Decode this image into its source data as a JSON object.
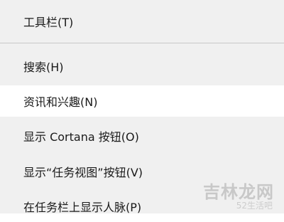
{
  "menu": {
    "items": [
      {
        "label": "工具栏(T)"
      },
      {
        "label": "搜索(H)"
      },
      {
        "label": "资讯和兴趣(N)"
      },
      {
        "label": "显示 Cortana 按钮(O)"
      },
      {
        "label": "显示“任务视图”按钮(V)"
      },
      {
        "label": "在任务栏上显示人脉(P)"
      }
    ],
    "highlighted_item": "资讯和兴趣(N)"
  },
  "watermark": {
    "text": "吉林龙网",
    "subtext": "52生活吧"
  },
  "colors": {
    "menu_background": "#f0f0f0",
    "highlight_background": "#ffffff",
    "separator": "#c8c8c8",
    "text": "#1a1a1a"
  }
}
